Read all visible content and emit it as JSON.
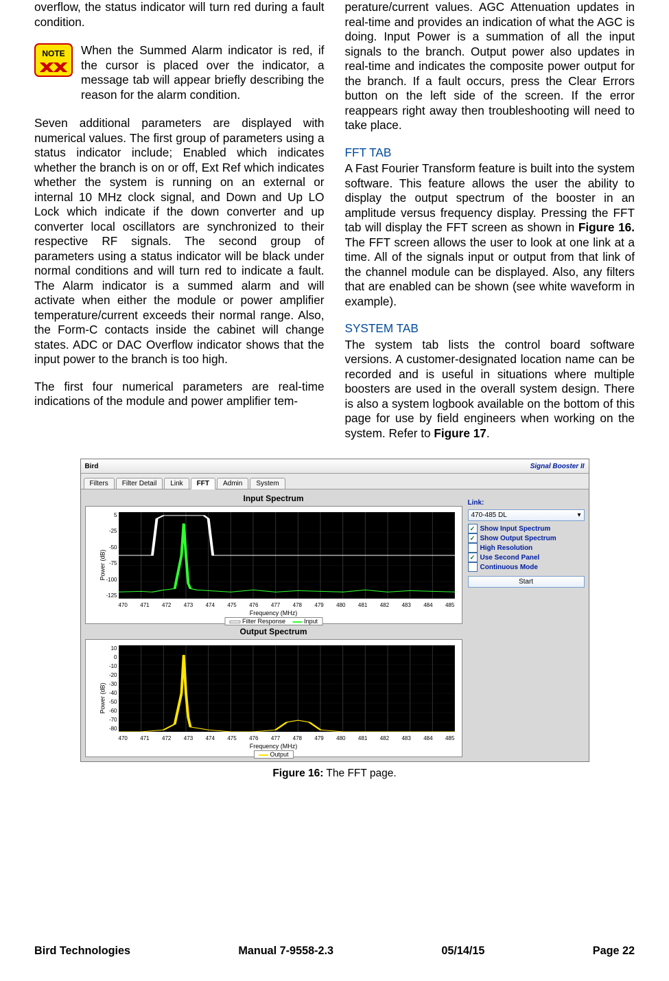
{
  "col_left": {
    "p1": "overflow, the status indicator will turn red during a fault condition.",
    "note_label": "NOTE",
    "note": "When the Summed Alarm indicator is red, if the cursor is placed over the indicator, a message tab will appear briefly describing the reason for the alarm condition.",
    "p2": "Seven additional parameters are displayed with numerical values. The first group of parameters using a status indicator include; Enabled which indicates whether the branch is on or off, Ext Ref which indicates whether the system is running on an external or internal 10 MHz clock signal, and Down and Up LO Lock which indicate if the down converter and up converter local oscillators are synchronized to their respective RF signals. The second group of parameters using a status indicator will be black under normal conditions and will turn red to indicate a fault. The Alarm indicator is a summed alarm and will activate when either the module or power amplifier temperature/current exceeds their normal range. Also, the Form-C contacts inside the cabinet will change states. ADC or DAC Overflow indicator shows that the input power to the branch is too high.",
    "p3": "The first four numerical parameters are real-time indications of the module and power amplifier tem-"
  },
  "col_right": {
    "p1": "perature/current values. AGC Attenuation updates in real-time and provides an indication of what the AGC is doing. Input Power is a summation of all the input signals to the branch. Output power also updates in real-time and indicates the composite power output for the branch. If a fault occurs, press the Clear Errors button on the left side of the screen. If the error reappears right away then troubleshooting will need to take place.",
    "h1": "FFT TAB",
    "p2a": "A Fast Fourier Transform feature is built into the system software. This feature allows the user the ability to display the output spectrum of the booster in an amplitude versus frequency display. Pressing the FFT tab will display the FFT screen as shown in ",
    "p2b": "Figure 16.",
    "p2c": " The FFT screen allows the user to look at one link at a time. All of the signals input or output from that link of the channel module can be displayed. Also, any filters that are enabled can be shown (see white waveform in example).",
    "h2": "SYSTEM TAB",
    "p3a": "The system tab lists the control board software versions. A customer-designated location name can be recorded and is useful in situations where multiple boosters are used in the overall system design. There is also a system logbook available on the bottom of this page for use by field engineers when working on the system. Refer to ",
    "p3b": "Figure 17",
    "p3c": "."
  },
  "screenshot": {
    "brand_left": "Bird",
    "brand_right": "Signal Booster II",
    "tabs": [
      "Filters",
      "Filter Detail",
      "Link",
      "FFT",
      "Admin",
      "System"
    ],
    "active_tab_index": 3,
    "chart1_title": "Input Spectrum",
    "chart2_title": "Output Spectrum",
    "ylabel": "Power (dB)",
    "xlabel": "Frequency (MHz)",
    "legend1": [
      "Filter Response",
      "Input"
    ],
    "legend2": [
      "Output"
    ],
    "side": {
      "link_label": "Link:",
      "link_select": "470-485 DL",
      "checks": [
        {
          "label": "Show Input Spectrum",
          "checked": true
        },
        {
          "label": "Show Output Spectrum",
          "checked": true
        },
        {
          "label": "High Resolution",
          "checked": false
        },
        {
          "label": "Use Second Panel",
          "checked": true
        },
        {
          "label": "Continuous Mode",
          "checked": false
        }
      ],
      "start": "Start"
    }
  },
  "caption_bold": "Figure 16:",
  "caption_rest": " The FFT page.",
  "footer": {
    "a": "Bird Technologies",
    "b": "Manual 7-9558-2.3",
    "c": "05/14/15",
    "d": "Page 22"
  },
  "chart_data": [
    {
      "type": "line",
      "title": "Input Spectrum",
      "xlabel": "Frequency (MHz)",
      "ylabel": "Power (dB)",
      "xlim": [
        470,
        485
      ],
      "ylim": [
        -125,
        5
      ],
      "xticks": [
        470,
        471,
        472,
        473,
        474,
        475,
        476,
        477,
        478,
        479,
        480,
        481,
        482,
        483,
        484,
        485
      ],
      "yticks": [
        5,
        -25,
        -50,
        -75,
        -100,
        -125
      ],
      "series": [
        {
          "name": "Filter Response",
          "color": "#ffffff",
          "x": [
            470.0,
            471.5,
            471.7,
            472.0,
            473.8,
            474.0,
            474.2,
            474.5,
            485.0
          ],
          "y": [
            -60,
            -60,
            -5,
            0,
            0,
            -5,
            -60,
            -60,
            -60
          ]
        },
        {
          "name": "Input",
          "color": "#2fff2f",
          "x": [
            470,
            471,
            471.5,
            472,
            472.5,
            472.8,
            472.9,
            473,
            473.1,
            473.2,
            473.5,
            474,
            475,
            476,
            477,
            478,
            479,
            480,
            481,
            482,
            483,
            484,
            485
          ],
          "y": [
            -115,
            -114,
            -115,
            -112,
            -110,
            -60,
            -12,
            -60,
            -102,
            -110,
            -112,
            -113,
            -115,
            -112,
            -115,
            -113,
            -114,
            -115,
            -112,
            -115,
            -113,
            -114,
            -115
          ]
        }
      ]
    },
    {
      "type": "line",
      "title": "Output Spectrum",
      "xlabel": "Frequency (MHz)",
      "ylabel": "Power (dB)",
      "xlim": [
        470,
        485
      ],
      "ylim": [
        -80,
        10
      ],
      "xticks": [
        470,
        471,
        472,
        473,
        474,
        475,
        476,
        477,
        478,
        479,
        480,
        481,
        482,
        483,
        484,
        485
      ],
      "yticks": [
        10,
        0,
        -10,
        -20,
        -30,
        -40,
        -50,
        -60,
        -70,
        -80
      ],
      "series": [
        {
          "name": "Output",
          "color": "#ffe400",
          "x": [
            470,
            471,
            472,
            472.5,
            472.8,
            472.9,
            473,
            473.1,
            473.2,
            474,
            475,
            476,
            477,
            477.5,
            478,
            478.5,
            479,
            480,
            481,
            482,
            483,
            484,
            485
          ],
          "y": [
            -80,
            -80,
            -78,
            -72,
            -40,
            0,
            -40,
            -65,
            -75,
            -78,
            -80,
            -80,
            -78,
            -70,
            -68,
            -70,
            -78,
            -80,
            -80,
            -80,
            -80,
            -80,
            -80
          ]
        }
      ]
    }
  ]
}
